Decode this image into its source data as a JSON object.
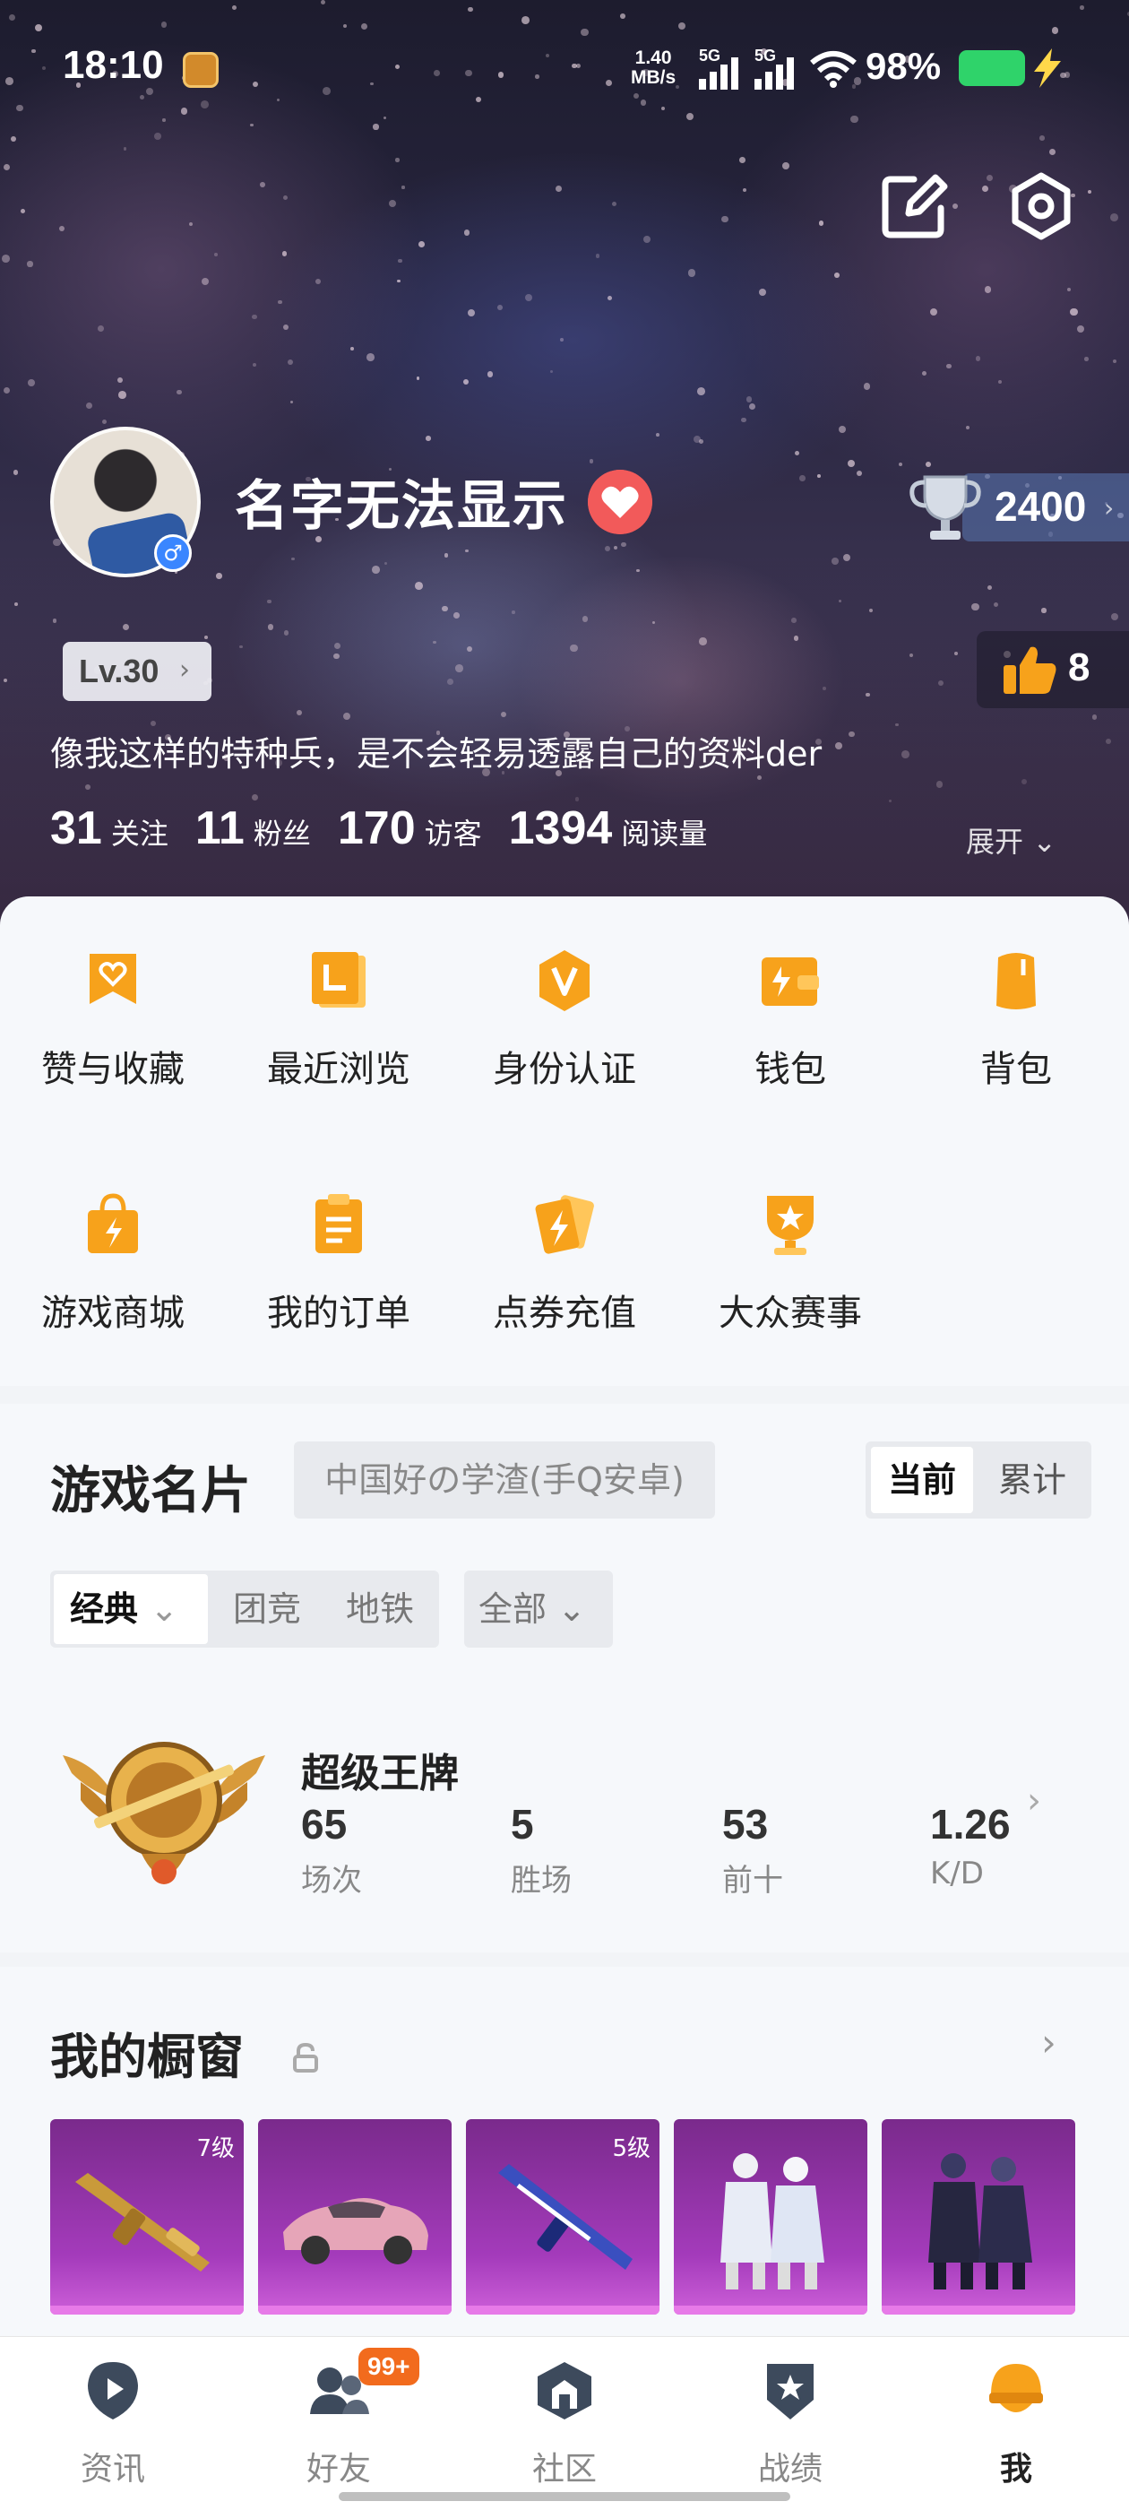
{
  "status_bar": {
    "time": "18:10",
    "net_speed_value": "1.40",
    "net_speed_unit": "MB/s",
    "sim1": "5G",
    "sim2": "5G",
    "battery": "98%"
  },
  "profile": {
    "nickname": "名字无法显示",
    "level": "Lv.30",
    "trophy_score": "2400",
    "likes": "8",
    "bio": "像我这样的特种兵，是不会轻易透露自己的资料der",
    "stats": [
      {
        "value": "31",
        "label": "关注"
      },
      {
        "value": "11",
        "label": "粉丝"
      },
      {
        "value": "170",
        "label": "访客"
      },
      {
        "value": "1394",
        "label": "阅读量"
      }
    ],
    "expand_label": "展开"
  },
  "menu": {
    "items": [
      {
        "label": "赞与收藏",
        "icon": "heart-bookmark-icon"
      },
      {
        "label": "最近浏览",
        "icon": "recent-browse-icon"
      },
      {
        "label": "身份认证",
        "icon": "verify-v-icon"
      },
      {
        "label": "钱包",
        "icon": "wallet-icon"
      },
      {
        "label": "背包",
        "icon": "backpack-icon"
      },
      {
        "label": "游戏商城",
        "icon": "shopping-bag-icon"
      },
      {
        "label": "我的订单",
        "icon": "order-clipboard-icon"
      },
      {
        "label": "点券充值",
        "icon": "coupon-recharge-icon"
      },
      {
        "label": "大众赛事",
        "icon": "tournament-trophy-icon"
      }
    ]
  },
  "game_card": {
    "title": "游戏名片",
    "account": "中国好の学渣(手Q安卓)",
    "toggle": [
      "当前",
      "累计"
    ],
    "modes": [
      "经典",
      "团竞",
      "地铁"
    ],
    "filter": "全部",
    "rank_name": "超级王牌",
    "stats": [
      {
        "value": "65",
        "label": "场次"
      },
      {
        "value": "5",
        "label": "胜场"
      },
      {
        "value": "53",
        "label": "前十"
      },
      {
        "value": "1.26",
        "label": "K/D"
      }
    ]
  },
  "showcase": {
    "title": "我的橱窗",
    "items": [
      {
        "level": "7级",
        "icon": "golden-rifle-icon"
      },
      {
        "level": "",
        "icon": "pink-sports-car-icon"
      },
      {
        "level": "5级",
        "icon": "blue-rifle-icon"
      },
      {
        "level": "",
        "icon": "white-outfit-pair-icon"
      },
      {
        "level": "",
        "icon": "dark-outfit-pair-icon"
      }
    ]
  },
  "tabbar": {
    "tabs": [
      {
        "label": "资讯",
        "icon": "news-play-icon"
      },
      {
        "label": "好友",
        "icon": "friends-icon",
        "badge": "99+"
      },
      {
        "label": "社区",
        "icon": "community-icon"
      },
      {
        "label": "战绩",
        "icon": "record-star-icon"
      },
      {
        "label": "我",
        "icon": "me-helmet-icon"
      }
    ]
  },
  "colors": {
    "accent_orange": "#f7a21b",
    "badge_orange": "#f26b1d",
    "battery_green": "#2fd36a",
    "showcase_purple": "#a43bbb"
  }
}
